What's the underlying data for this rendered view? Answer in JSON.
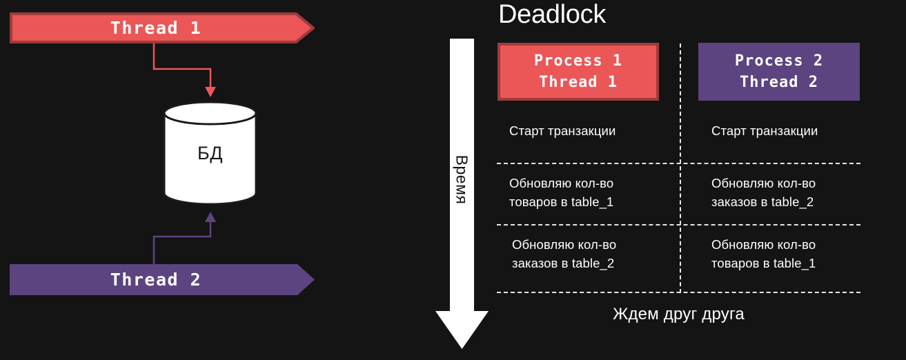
{
  "colors": {
    "background": "#141414",
    "red": "#EB5757",
    "red_border": "#9E3B3B",
    "purple": "#5B4480",
    "white": "#FFFFFF",
    "dashed_line": "#E8E8E8",
    "db_fill": "#FFFFFF",
    "db_stroke": "#1A1A1A"
  },
  "left_diagram": {
    "thread1_label": "Thread 1",
    "thread2_label": "Thread 2",
    "database_label": "БД"
  },
  "right_diagram": {
    "title": "Deadlock",
    "time_axis_label": "Время",
    "columns": [
      {
        "header_line1": "Process 1",
        "header_line2": "Thread 1",
        "steps": [
          "Старт транзакции",
          "Обновляю кол-во товаров в table_1",
          "Обновляю кол-во заказов в table_2"
        ]
      },
      {
        "header_line1": "Process 2",
        "header_line2": "Thread 2",
        "steps": [
          "Старт транзакции",
          "Обновляю кол-во заказов в table_2",
          "Обновляю кол-во товаров в table_1"
        ]
      }
    ],
    "footer_text": "Ждем друг друга"
  }
}
